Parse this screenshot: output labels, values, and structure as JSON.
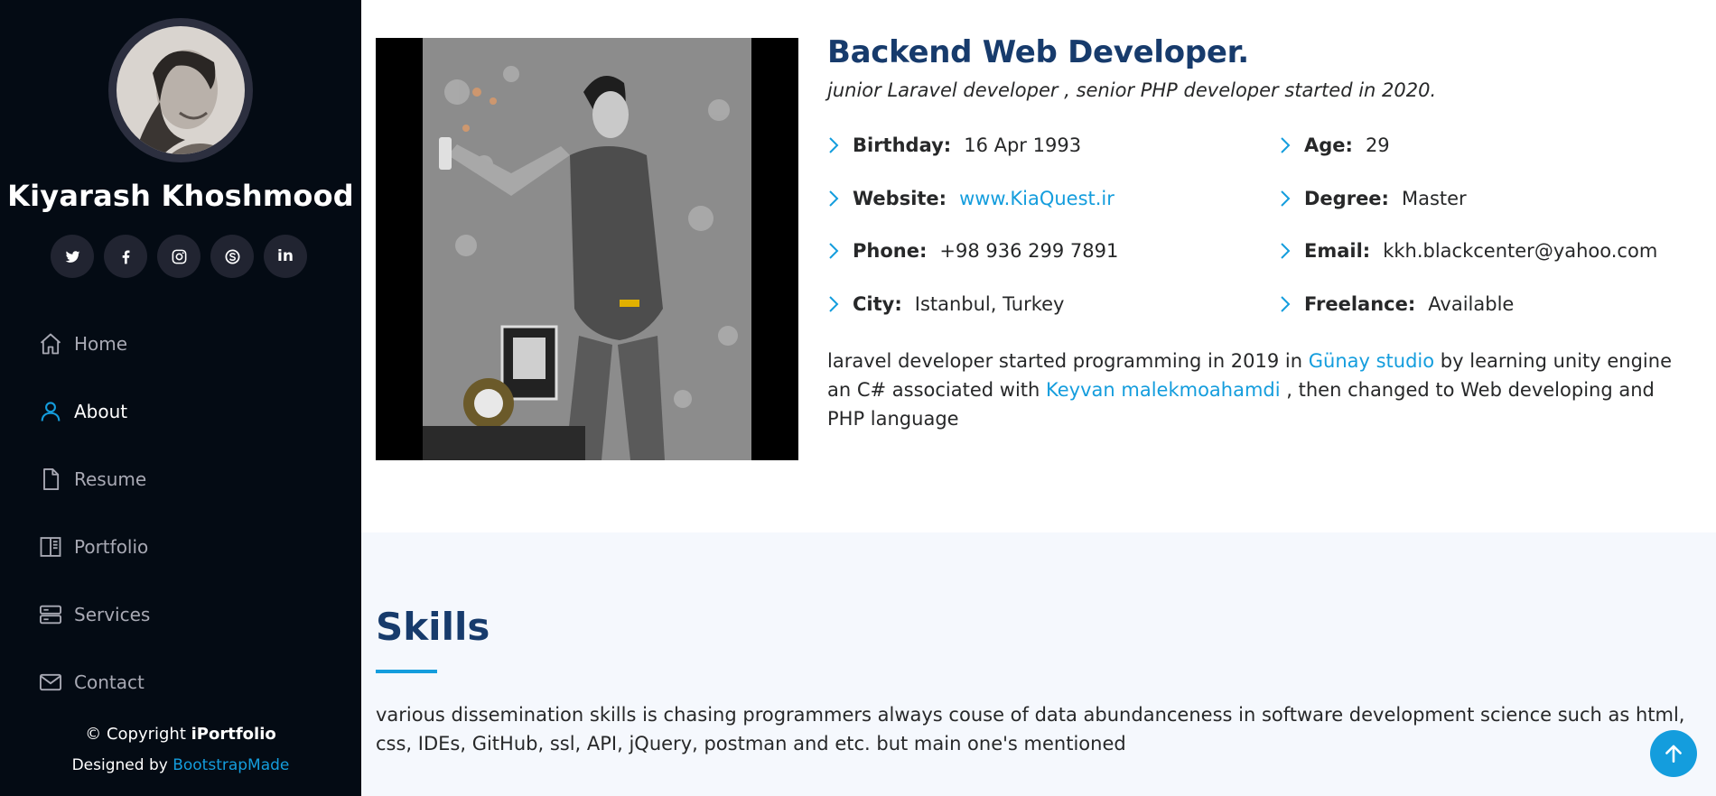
{
  "sidebar": {
    "name": "Kiyarash Khoshmood",
    "avatar_alt": "profile photo",
    "social": [
      {
        "icon": "twitter-icon"
      },
      {
        "icon": "facebook-icon"
      },
      {
        "icon": "instagram-icon"
      },
      {
        "icon": "skype-icon"
      },
      {
        "icon": "linkedin-icon",
        "label": "in"
      }
    ],
    "nav": [
      {
        "label": "Home",
        "icon": "home-icon",
        "active": false
      },
      {
        "label": "About",
        "icon": "person-icon",
        "active": true
      },
      {
        "label": "Resume",
        "icon": "file-icon",
        "active": false
      },
      {
        "label": "Portfolio",
        "icon": "book-icon",
        "active": false
      },
      {
        "label": "Services",
        "icon": "server-icon",
        "active": false
      },
      {
        "label": "Contact",
        "icon": "envelope-icon",
        "active": false
      }
    ],
    "copyright_prefix": "© Copyright",
    "copyright_brand": "iPortfolio",
    "credits_prefix": "Designed by",
    "credits_link": "BootstrapMade"
  },
  "about": {
    "title": "Backend Web Developer.",
    "subtitle": "junior Laravel developer , senior PHP developer started in 2020.",
    "details": [
      {
        "label": "Birthday:",
        "value": "16 Apr 1993"
      },
      {
        "label": "Age:",
        "value": "29"
      },
      {
        "label": "Website:",
        "value": "www.KiaQuest.ir"
      },
      {
        "label": "Degree:",
        "value": "Master"
      },
      {
        "label": "Phone:",
        "value": "+98 936 299 7891"
      },
      {
        "label": "Email:",
        "value": "kkh.blackcenter@yahoo.com"
      },
      {
        "label": "City:",
        "value": "Istanbul, Turkey"
      },
      {
        "label": "Freelance:",
        "value": "Available"
      }
    ],
    "text": {
      "part1": "laravel developer started programming in 2019 in ",
      "link1": "Günay studio",
      "part2": " by learning unity engine an C# associated with ",
      "link2": "Keyvan malekmoahamdi",
      "part3": " , then changed to Web developing and PHP language"
    }
  },
  "skills": {
    "title": "Skills",
    "text": "various dissemination skills is chasing programmers always couse of data abundanceness in software development science such as html, css, IDEs, GitHub, ssl, API, jQuery, postman and etc. but main one's mentioned"
  },
  "colors": {
    "sidebar_bg": "#040b14",
    "accent": "#149ddd",
    "heading": "#173b6c",
    "section_alt_bg": "#f5f8fd"
  }
}
